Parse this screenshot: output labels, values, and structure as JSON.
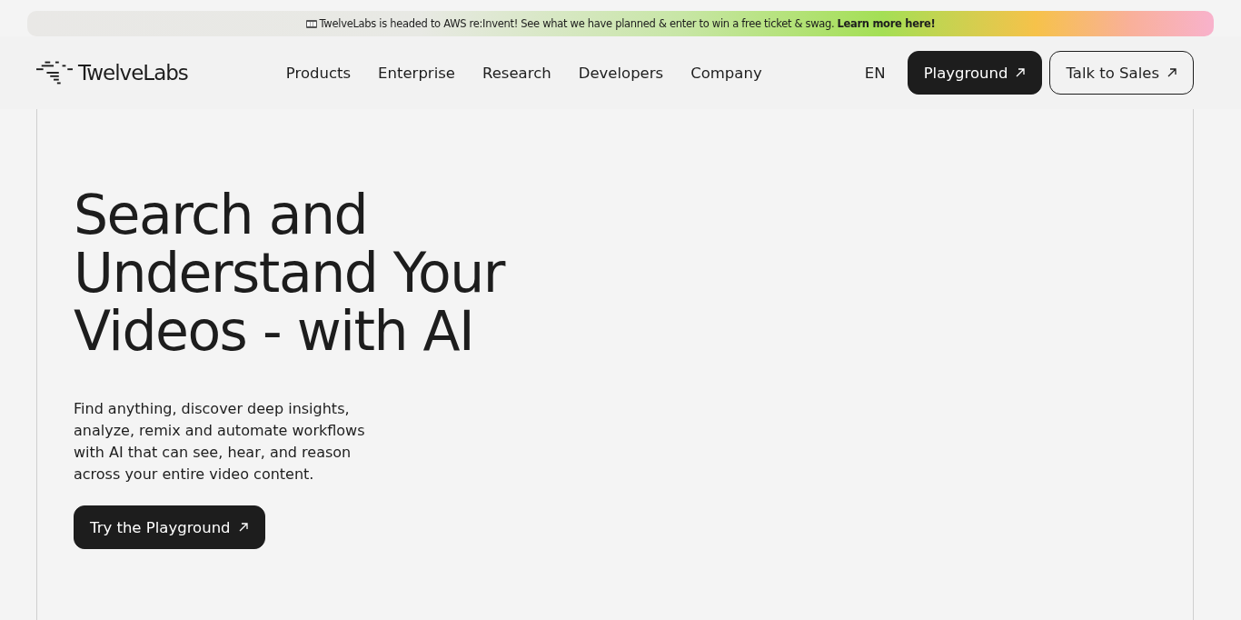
{
  "announcement": {
    "text": "TwelveLabs is headed to AWS re:Invent! See what we have planned & enter to win a free ticket & swag.",
    "link": "Learn more here!"
  },
  "header": {
    "logo": "TwelveLabs",
    "nav": [
      "Products",
      "Enterprise",
      "Research",
      "Developers",
      "Company"
    ],
    "language": "EN",
    "buttons": [
      {
        "label": "Playground",
        "kind": "primary"
      },
      {
        "label": "Talk to Sales",
        "kind": "outline"
      }
    ]
  },
  "hero": {
    "title": "Search and Understand Your Videos - with AI",
    "description": "Find anything, discover deep insights, analyze, remix and automate workflows with AI that can see, hear, and reason across your entire video content.",
    "cta": "Try the Playground"
  }
}
